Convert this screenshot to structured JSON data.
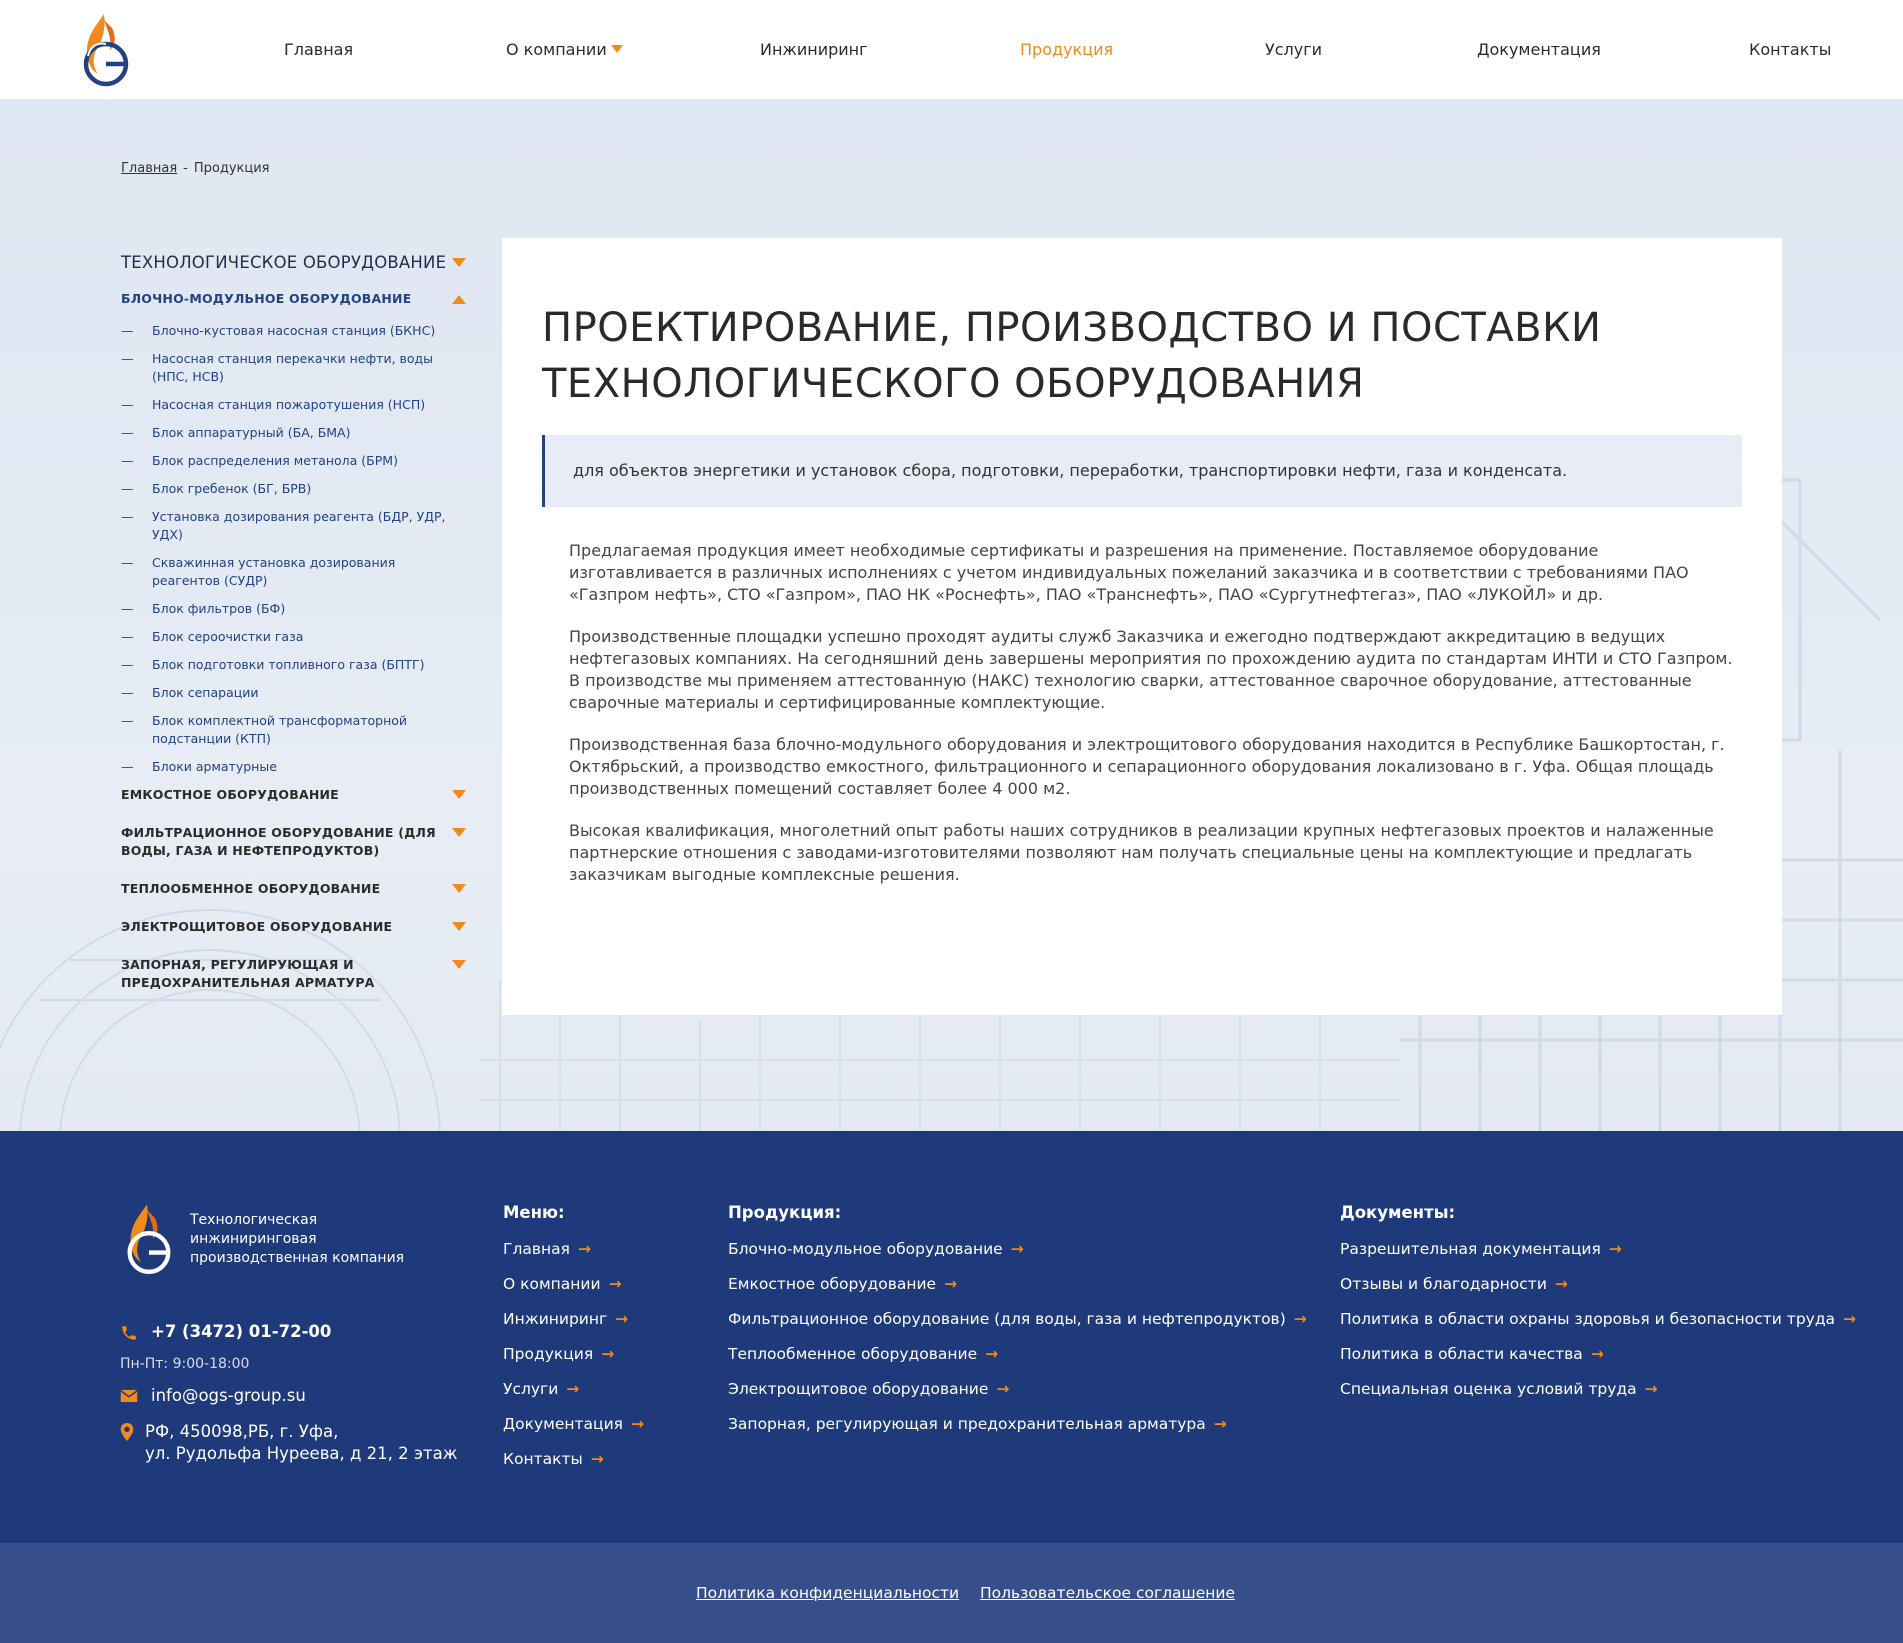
{
  "header": {
    "nav": [
      {
        "label": "Главная"
      },
      {
        "label": "О компании"
      },
      {
        "label": "Инжиниринг"
      },
      {
        "label": "Продукция"
      },
      {
        "label": "Услуги"
      },
      {
        "label": "Документация"
      },
      {
        "label": "Контакты"
      }
    ],
    "active_item": "Продукция"
  },
  "breadcrumb": {
    "home": "Главная",
    "separator": "-",
    "current": "Продукция"
  },
  "sidebar": {
    "section_title": "ТЕХНОЛОГИЧЕСКОЕ ОБОРУДОВАНИЕ",
    "subsection_title": "БЛОЧНО-МОДУЛЬНОЕ ОБОРУДОВАНИЕ",
    "dash": "—",
    "items": [
      "Блочно-кустовая насосная станция (БКНС)",
      "Насосная станция перекачки нефти, воды (НПС, НСВ)",
      "Насосная станция пожаротушения (НСП)",
      "Блок аппаратурный (БА, БМА)",
      "Блок распределения метанола (БРМ)",
      "Блок гребенок (БГ, БРВ)",
      "Установка дозирования реагента (БДР, УДР, УДХ)",
      "Скважинная установка дозирования реагентов (СУДР)",
      "Блок фильтров (БФ)",
      "Блок сероочистки газа",
      "Блок подготовки топливного газа (БПТГ)",
      "Блок сепарации",
      "Блок комплектной трансформаторной подстанции (КТП)",
      "Блоки арматурные"
    ],
    "categories": [
      "ЕМКОСТНОЕ ОБОРУДОВАНИЕ",
      "ФИЛЬТРАЦИОННОЕ ОБОРУДОВАНИЕ (ДЛЯ ВОДЫ, ГАЗА И НЕФТЕПРОДУКТОВ)",
      "ТЕПЛООБМЕННОЕ ОБОРУДОВАНИЕ",
      "ЭЛЕКТРОЩИТОВОЕ ОБОРУДОВАНИЕ",
      "ЗАПОРНАЯ, РЕГУЛИРУЮЩАЯ И ПРЕДОХРАНИТЕЛЬНАЯ АРМАТУРА"
    ]
  },
  "main": {
    "title": "ПРОЕКТИРОВАНИЕ, ПРОИЗВОДСТВО И ПОСТАВКИ ТЕХНОЛОГИЧЕСКОГО ОБОРУДОВАНИЯ",
    "lead": "для объектов энергетики и установок сбора, подготовки, переработки, транспортировки нефти, газа и конденсата.",
    "paragraphs": [
      "Предлагаемая продукция имеет необходимые сертификаты и разрешения на применение. Поставляемое оборудование изготавливается в различных исполнениях с учетом индивидуальных пожеланий заказчика и в соответствии с требованиями ПАО «Газпром нефть», СТО «Газпром», ПАО НК «Роснефть», ПАО «Транснефть», ПАО «Сургутнефтегаз», ПАО «ЛУКОЙЛ» и др.",
      "Производственные площадки успешно проходят аудиты служб Заказчика и ежегодно подтверждают аккредитацию в ведущих нефтегазовых компаниях. На сегодняшний день завершены мероприятия по прохождению аудита по стандартам ИНТИ и СТО Газпром. В производстве мы применяем аттестованную (НАКС) технологию сварки, аттестованное сварочное оборудование, аттестованные сварочные материалы и сертифицированные комплектующие.",
      "Производственная база блочно-модульного оборудования и электрощитового оборудования находится в Республике Башкортостан, г. Октябрьский, а производство емкостного, фильтрационного и сепарационного оборудования локализовано в г. Уфа. Общая площадь производственных помещений составляет более 4 000 м2.",
      "Высокая квалификация, многолетний опыт работы наших сотрудников в реализации крупных нефтегазовых проектов и налаженные партнерские отношения с заводами-изготовителями позволяют нам получать специальные цены на комплектующие и предлагать заказчикам выгодные комплексные решения."
    ]
  },
  "footer": {
    "tagline": "Технологическая инжиниринговая производственная компания",
    "phone": "+7 (3472) 01-72-00",
    "hours": "Пн-Пт: 9:00-18:00",
    "email": "info@ogs-group.su",
    "address_line1": "РФ, 450098,РБ, г. Уфа,",
    "address_line2": "ул. Рудольфа Нуреева, д 21, 2 этаж",
    "arrow": "→",
    "menu": {
      "title": "Меню:",
      "items": [
        "Главная",
        "О компании",
        "Инжиниринг",
        "Продукция",
        "Услуги",
        "Документация",
        "Контакты"
      ]
    },
    "products": {
      "title": "Продукция:",
      "items": [
        "Блочно-модульное оборудование",
        "Емкостное оборудование",
        "Фильтрационное оборудование (для воды, газа и нефтепродуктов)",
        "Теплообменное оборудование",
        "Электрощитовое оборудование",
        "Запорная, регулирующая и предохранительная арматура"
      ]
    },
    "documents": {
      "title": "Документы:",
      "items": [
        "Разрешительная документация",
        "Отзывы и благодарности",
        "Политика в области охраны здоровья и безопасности труда",
        "Политика в области качества",
        "Специальная оценка условий труда"
      ]
    },
    "bottom_links": [
      "Политика конфиденциальности",
      "Пользовательское соглашение"
    ]
  },
  "colors": {
    "accent": "#f08a1c",
    "brand_blue": "#24427f",
    "footer_bg": "#1f3a7a",
    "bottombar_bg": "#364f8b"
  },
  "icons": [
    "logo-flame-icon",
    "phone-icon",
    "mail-icon",
    "location-pin-icon",
    "caret-down-icon",
    "caret-up-icon",
    "arrow-right-icon"
  ]
}
